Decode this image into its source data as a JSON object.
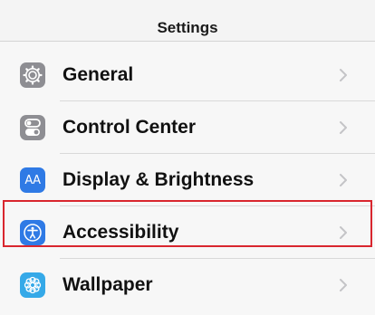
{
  "header": {
    "title": "Settings"
  },
  "rows": [
    {
      "label": "General",
      "icon": "gear-icon",
      "icon_color": "#8e8e93"
    },
    {
      "label": "Control Center",
      "icon": "toggle-switches-icon",
      "icon_color": "#8e8e93"
    },
    {
      "label": "Display & Brightness",
      "icon": "text-size-icon",
      "icon_color": "#2f7ae5",
      "icon_text": "AA"
    },
    {
      "label": "Accessibility",
      "icon": "accessibility-person-icon",
      "icon_color": "#2f7ae5"
    },
    {
      "label": "Wallpaper",
      "icon": "flower-icon",
      "icon_color": "#35a9e8"
    }
  ],
  "highlight": {
    "row": "Accessibility",
    "color": "#d9262e"
  }
}
